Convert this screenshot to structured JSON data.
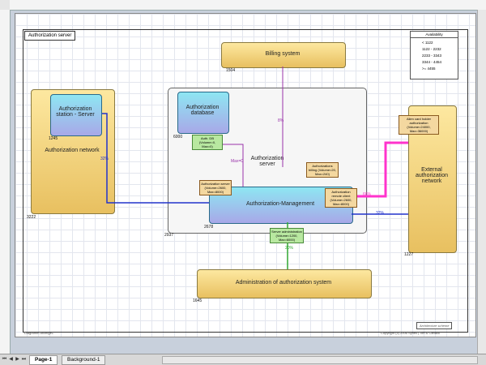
{
  "frame_title": "Authorization server",
  "legend": {
    "title": "Availability",
    "items": [
      "< 1122",
      "1122 - 2232",
      "2233 - 3343",
      "3344 - 4454",
      ">= 4455"
    ]
  },
  "nodes": {
    "billing": {
      "label": "Billing system",
      "num": "1504"
    },
    "auth_network": {
      "label": "Authorization network",
      "num": "3222"
    },
    "auth_station": {
      "label": "Authorization station - Server",
      "num": "1245"
    },
    "auth_server_group": {
      "label": "Authorization server",
      "num": "2937"
    },
    "auth_db": {
      "label": "Authorization database",
      "num": "6000"
    },
    "auth_mgmt": {
      "label": "Authorization-Management",
      "num": "2678"
    },
    "external": {
      "label": "External authorization network",
      "num": "1227"
    },
    "admin": {
      "label": "Administration of authorization system",
      "num": "1645"
    }
  },
  "notes": {
    "auth_db": "Auth. DB (Volume=0, Max=0)",
    "auth_server": "Authorization server (Volume=2600, Max=8000)",
    "billing": "Authorizations billing (Volume=20, Max=240)",
    "remote": "Authorization remote client (Volume=2600, Max=8000)",
    "server_admin": "Server administration (Volume=1200, Max=6000)",
    "external": "Alien card holder authorization (Volume=24000, Max=36000)"
  },
  "edge_labels": {
    "billing_pct": "8%",
    "station_pct": "32%",
    "max0": "Max=0",
    "remote_pct": "66%",
    "external_pct": "32%",
    "admin_pct": "20%"
  },
  "footer_left": "Diagramm Anzeige1",
  "footer_right": "Copyright (c) 2006 Synell | Ton & Carlack",
  "footer_box": "Architecture scheme",
  "tabs": [
    "Page-1",
    "Background-1"
  ],
  "colors": {
    "gold": "#e8c060",
    "cyan": "#8ee6f2",
    "blue_link": "#2233cc",
    "magenta_link": "#ff33cc",
    "purple_link": "#9933aa",
    "green_link": "#33aa33"
  }
}
